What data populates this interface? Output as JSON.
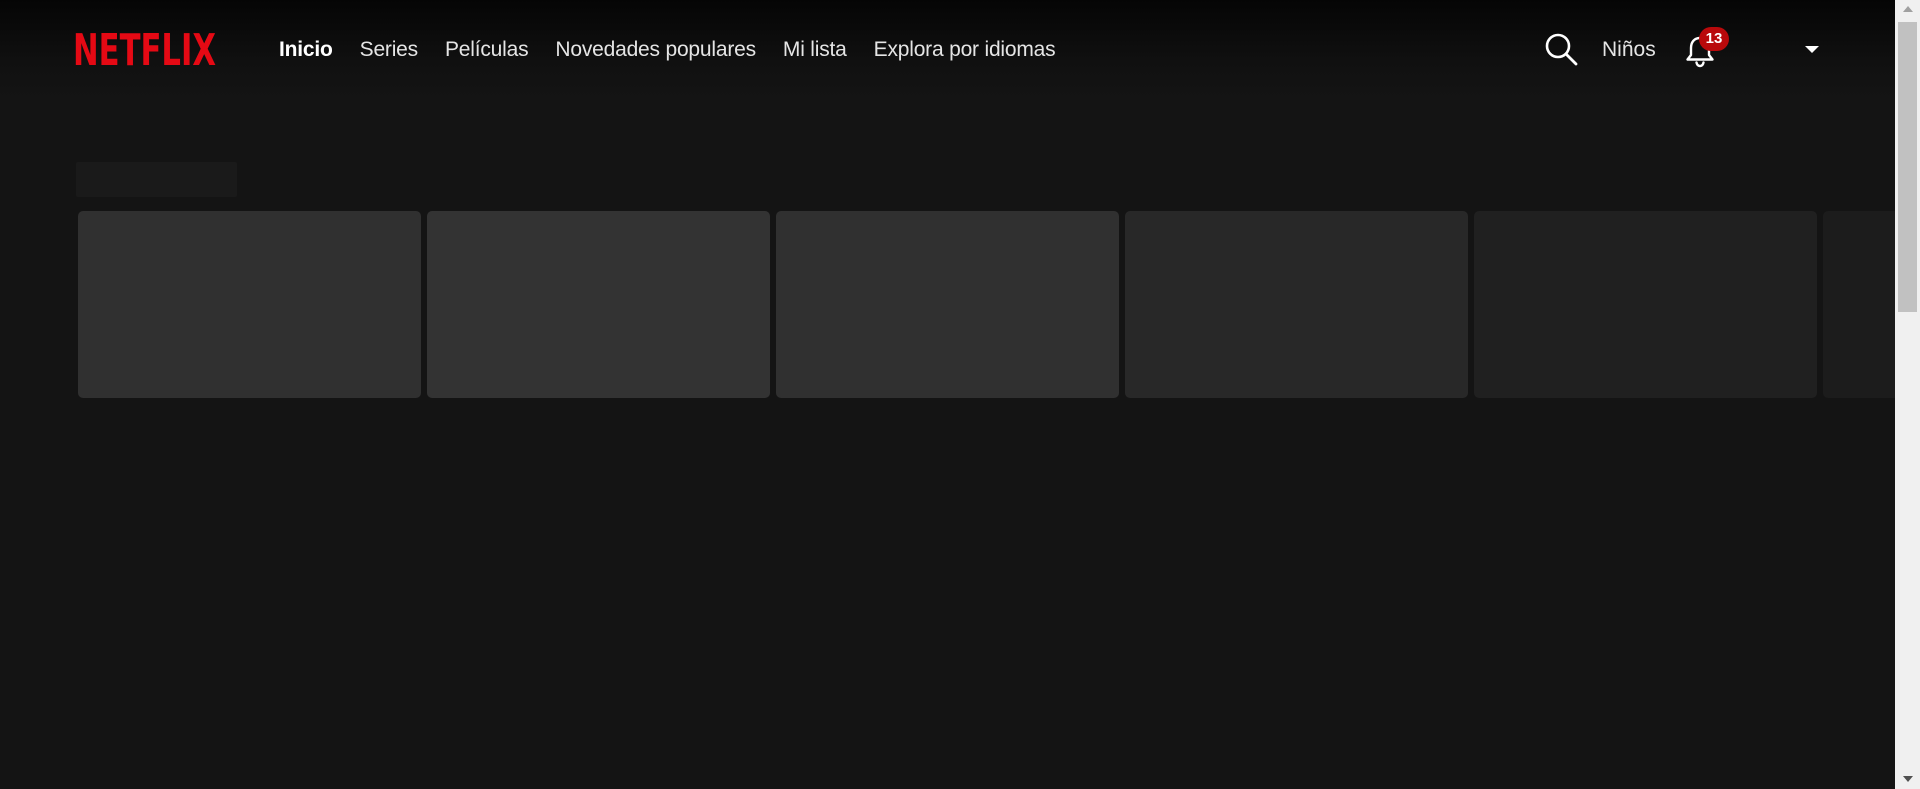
{
  "app": {
    "brand": "NETFLIX",
    "brand_color": "#e50914"
  },
  "nav": {
    "links": [
      {
        "label": "Inicio",
        "active": true
      },
      {
        "label": "Series",
        "active": false
      },
      {
        "label": "Películas",
        "active": false
      },
      {
        "label": "Novedades populares",
        "active": false
      },
      {
        "label": "Mi lista",
        "active": false
      },
      {
        "label": "Explora por idiomas",
        "active": false
      }
    ]
  },
  "header_right": {
    "search_icon": "search-icon",
    "kids_label": "Niños",
    "notifications_icon": "bell-icon",
    "notification_count": "13",
    "badge_color": "#b9090b",
    "profile_menu_icon": "caret-down-icon"
  },
  "content": {
    "loading_row": {
      "card_colors": [
        "#303030",
        "#333333",
        "#303030",
        "#282828",
        "#202020",
        "#1c1c1c"
      ]
    }
  },
  "colors": {
    "background": "#141414",
    "text": "#e5e5e5"
  }
}
